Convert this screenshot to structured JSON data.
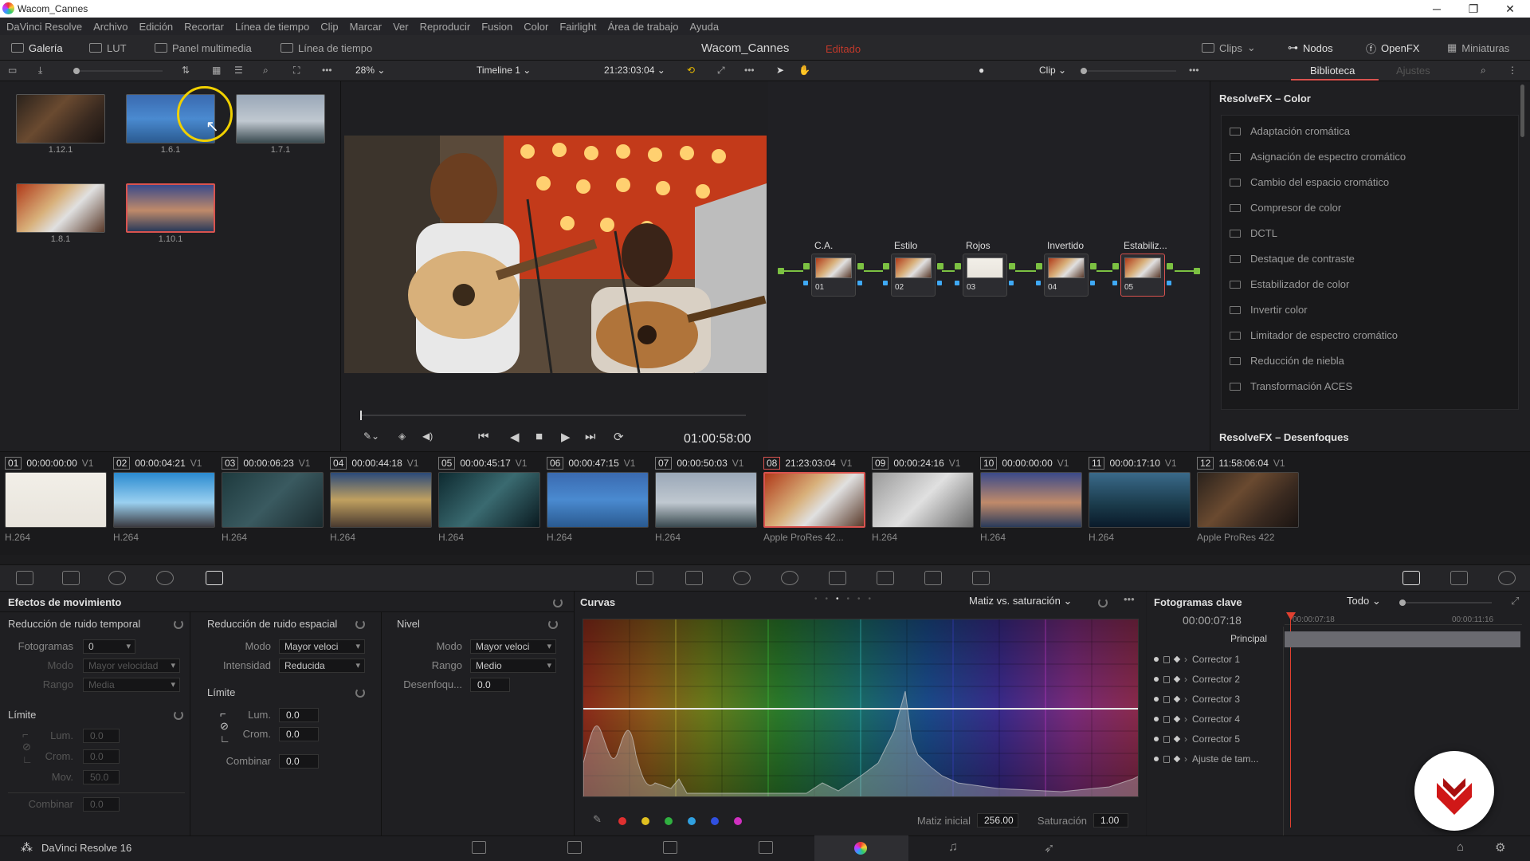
{
  "window": {
    "title": "Wacom_Cannes",
    "minimize": "─",
    "maximize": "❐",
    "close": "✕"
  },
  "menu": [
    "DaVinci Resolve",
    "Archivo",
    "Edición",
    "Recortar",
    "Línea de tiempo",
    "Clip",
    "Marcar",
    "Ver",
    "Reproducir",
    "Fusion",
    "Color",
    "Fairlight",
    "Área de trabajo",
    "Ayuda"
  ],
  "toolbar": {
    "gallery": "Galería",
    "lut": "LUT",
    "media_pool": "Panel multimedia",
    "timeline": "Línea de tiempo",
    "project_title": "Wacom_Cannes",
    "project_status": "Editado",
    "clips": "Clips",
    "nodes": "Nodos",
    "openfx": "OpenFX",
    "thumbnails": "Miniaturas"
  },
  "viewer_bar": {
    "zoom": "28%",
    "timeline_name": "Timeline 1",
    "timecode": "21:23:03:04",
    "node_mode": "Clip",
    "library_tab": "Biblioteca",
    "settings_tab": "Ajustes"
  },
  "gallery": {
    "stills": [
      {
        "label": "1.12.1",
        "palette": "stage"
      },
      {
        "label": "1.6.1",
        "palette": "sign"
      },
      {
        "label": "1.7.1",
        "palette": "palm"
      },
      {
        "label": "1.8.1",
        "palette": "concert"
      },
      {
        "label": "1.10.1",
        "palette": "sunset",
        "selected": true
      }
    ]
  },
  "viewer": {
    "timecode": "01:00:58:00"
  },
  "nodes": [
    {
      "label": "C.A.",
      "num": "01"
    },
    {
      "label": "Estilo",
      "num": "02"
    },
    {
      "label": "Rojos",
      "num": "03"
    },
    {
      "label": "Invertido",
      "num": "04"
    },
    {
      "label": "Estabiliz...",
      "num": "05",
      "selected": true
    }
  ],
  "library": {
    "section1": "ResolveFX – Color",
    "items": [
      "Adaptación cromática",
      "Asignación de espectro cromático",
      "Cambio del espacio cromático",
      "Compresor de color",
      "DCTL",
      "Destaque de contraste",
      "Estabilizador de color",
      "Invertir color",
      "Limitador de espectro cromático",
      "Reducción de niebla",
      "Transformación ACES"
    ],
    "section2": "ResolveFX – Desenfoques"
  },
  "clips": [
    {
      "idx": "01",
      "tc": "00:00:00:00",
      "trk": "V1",
      "codec": "H.264",
      "tone": "white"
    },
    {
      "idx": "02",
      "tc": "00:00:04:21",
      "trk": "V1",
      "codec": "H.264",
      "tone": "cannes"
    },
    {
      "idx": "03",
      "tc": "00:00:06:23",
      "trk": "V1",
      "codec": "H.264",
      "tone": "wacom"
    },
    {
      "idx": "04",
      "tc": "00:00:44:18",
      "trk": "V1",
      "codec": "H.264",
      "tone": "crowd"
    },
    {
      "idx": "05",
      "tc": "00:00:45:17",
      "trk": "V1",
      "codec": "H.264",
      "tone": "leaf"
    },
    {
      "idx": "06",
      "tc": "00:00:47:15",
      "trk": "V1",
      "codec": "H.264",
      "tone": "sign"
    },
    {
      "idx": "07",
      "tc": "00:00:50:03",
      "trk": "V1",
      "codec": "H.264",
      "tone": "palm"
    },
    {
      "idx": "08",
      "tc": "21:23:03:04",
      "trk": "V1",
      "codec": "Apple ProRes 42...",
      "tone": "concert",
      "selected": true
    },
    {
      "idx": "09",
      "tc": "00:00:24:16",
      "trk": "V1",
      "codec": "H.264",
      "tone": "bw"
    },
    {
      "idx": "10",
      "tc": "00:00:00:00",
      "trk": "V1",
      "codec": "H.264",
      "tone": "sunset"
    },
    {
      "idx": "11",
      "tc": "00:00:17:10",
      "trk": "V1",
      "codec": "H.264",
      "tone": "sea"
    },
    {
      "idx": "12",
      "tc": "11:58:06:04",
      "trk": "V1",
      "codec": "Apple ProRes 422",
      "tone": "stage"
    }
  ],
  "motion": {
    "title": "Efectos de movimiento",
    "temporal": {
      "title": "Reducción de ruido temporal",
      "frames_label": "Fotogramas",
      "frames": "0",
      "mode_label": "Modo",
      "mode": "Mayor velocidad",
      "range_label": "Rango",
      "range": "Media"
    },
    "limit": {
      "title": "Límite",
      "lum_label": "Lum.",
      "lum": "0.0",
      "crom_label": "Crom.",
      "crom": "0.0",
      "mov_label": "Mov.",
      "mov": "50.0",
      "combine_label": "Combinar",
      "combine": "0.0"
    },
    "spatial": {
      "title": "Reducción de ruido espacial",
      "mode_label": "Modo",
      "mode": "Mayor veloci",
      "intensity_label": "Intensidad",
      "intensity": "Reducida"
    },
    "slimit": {
      "title": "Límite",
      "lum_label": "Lum.",
      "lum": "0.0",
      "crom_label": "Crom.",
      "crom": "0.0",
      "combine_label": "Combinar",
      "combine": "0.0"
    },
    "level": {
      "title": "Nivel",
      "mode_label": "Modo",
      "mode": "Mayor veloci",
      "range_label": "Rango",
      "range": "Medio",
      "blur_label": "Desenfoqu...",
      "blur": "0.0"
    }
  },
  "curves": {
    "title": "Curvas",
    "mode": "Matiz vs. saturación",
    "hue_label": "Matiz inicial",
    "hue": "256.00",
    "sat_label": "Saturación",
    "sat": "1.00",
    "dots": [
      "#e03030",
      "#e0c020",
      "#30b040",
      "#30a0e0",
      "#3050e0",
      "#d030c0"
    ]
  },
  "keyframes": {
    "title": "Fotogramas clave",
    "filter": "Todo",
    "tc": "00:00:07:18",
    "ruler1": "00:00:07:18",
    "ruler2": "00:00:11:16",
    "main": "Principal",
    "rows": [
      "Corrector 1",
      "Corrector 2",
      "Corrector 3",
      "Corrector 4",
      "Corrector 5",
      "Ajuste de tam..."
    ]
  },
  "status": {
    "app": "DaVinci Resolve 16"
  }
}
